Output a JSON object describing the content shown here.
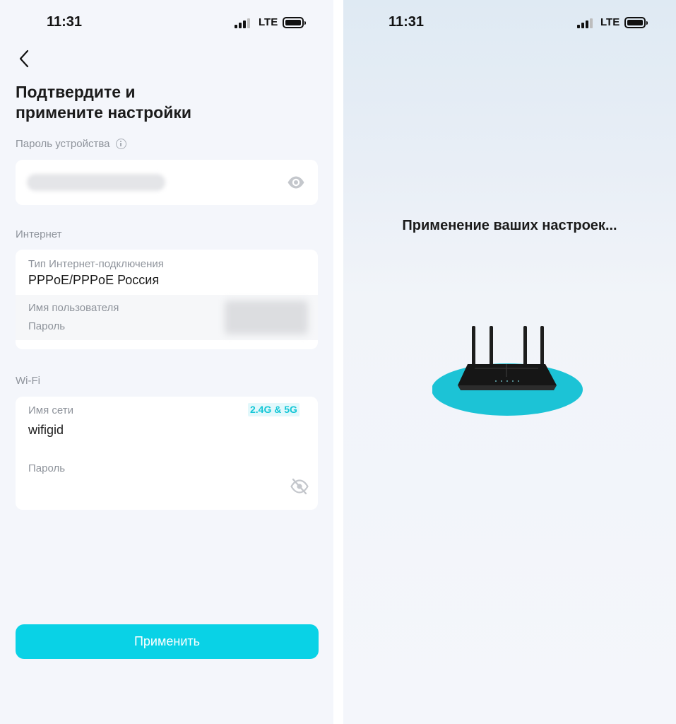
{
  "colors": {
    "accent": "#09d2e6",
    "badge_text": "#12c6d6",
    "background": "#f4f6fb",
    "card": "#ffffff",
    "muted_text": "#8e939b"
  },
  "left_screen": {
    "status_bar": {
      "time": "11:31",
      "network": "LTE",
      "signal_bars_active": 3,
      "signal_bars_total": 4
    },
    "back_icon": "chevron-left-icon",
    "title": "Подтвердите и\nпримените настройки",
    "device_password": {
      "label": "Пароль устройства",
      "info_icon": "info-icon",
      "eye_icon": "eye-icon"
    },
    "internet": {
      "section_label": "Интернет",
      "connection_type_label": "Тип Интернет-подключения",
      "connection_type_value": "PPPoE/PPPoE Россия",
      "username_label": "Имя пользователя",
      "password_label": "Пароль"
    },
    "wifi": {
      "section_label": "Wi-Fi",
      "ssid_label": "Имя сети",
      "band_badge": "2.4G & 5G",
      "ssid_value": "wifigid",
      "password_label": "Пароль",
      "eye_icon": "eye-off-icon"
    },
    "apply_button": "Применить"
  },
  "right_screen": {
    "status_bar": {
      "time": "11:31",
      "network": "LTE",
      "signal_bars_active": 3,
      "signal_bars_total": 4
    },
    "message": "Применение ваших настроек...",
    "illustration": "router-icon"
  }
}
